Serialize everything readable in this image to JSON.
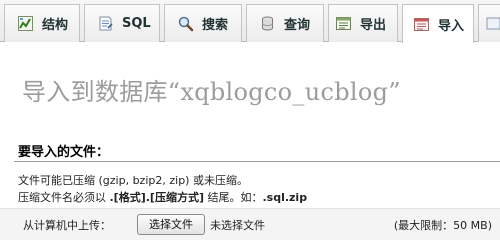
{
  "tabs": [
    {
      "label": "结构",
      "icon": "structure-icon"
    },
    {
      "label": "SQL",
      "icon": "sql-icon"
    },
    {
      "label": "搜索",
      "icon": "search-icon"
    },
    {
      "label": "查询",
      "icon": "query-icon"
    },
    {
      "label": "导出",
      "icon": "export-icon"
    },
    {
      "label": "导入",
      "icon": "import-icon",
      "active": true
    }
  ],
  "page_title": "导入到数据库“xqblogco_ucblog”",
  "section_title": "要导入的文件：",
  "info": {
    "compression_note": "文件可能已压缩 (gzip, bzip2, zip) 或未压缩。",
    "format_prefix": "压缩文件名必须以 ",
    "format_pattern": ".[格式].[压缩方式]",
    "format_middle": " 结尾。如：",
    "format_example": ".sql.zip"
  },
  "upload": {
    "label": "从计算机中上传：",
    "choose_button": "选择文件",
    "no_file_text": "未选择文件",
    "max_limit": "(最大限制：50 MB)"
  },
  "colors": {
    "title_gray": "#9c9c9c",
    "tab_text": "#223333"
  }
}
